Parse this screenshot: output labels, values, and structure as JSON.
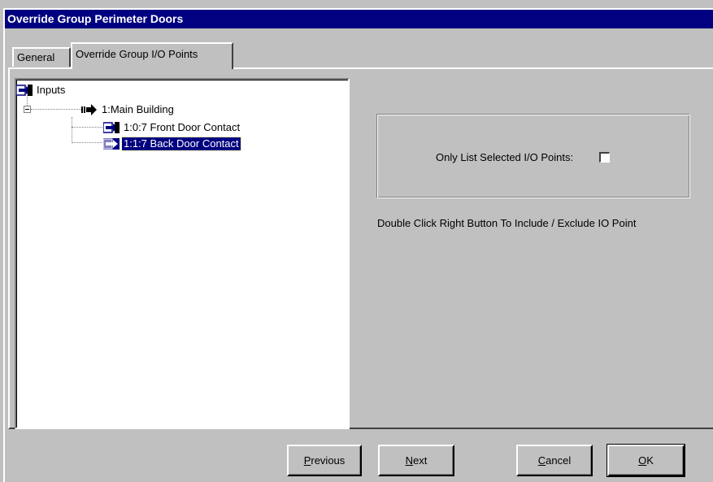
{
  "window": {
    "title": "Override Group Perimeter Doors"
  },
  "tabs": [
    {
      "label": "General",
      "active": false
    },
    {
      "label": "Override Group I/O Points",
      "active": true
    }
  ],
  "tree": {
    "root": {
      "label": "Inputs",
      "icon": "io-point-icon"
    },
    "group": {
      "label": "1:Main Building",
      "icon": "arrow-right-icon",
      "expanded": true
    },
    "items": [
      {
        "label": "1:0:7  Front Door Contact",
        "icon": "io-point-icon",
        "selected": false
      },
      {
        "label": "1:1:7  Back Door Contact",
        "icon": "io-point-icon",
        "selected": true
      }
    ]
  },
  "options": {
    "only_list_selected_label": "Only List Selected I/O Points:",
    "only_list_selected_checked": false
  },
  "hint": "Double Click Right Button To Include / Exclude IO Point",
  "buttons": {
    "previous": {
      "mnemonic": "P",
      "rest": "revious"
    },
    "next": {
      "mnemonic": "N",
      "rest": "ext"
    },
    "cancel": {
      "mnemonic": "C",
      "rest": "ancel"
    },
    "ok": {
      "mnemonic": "O",
      "rest": "K"
    }
  },
  "colors": {
    "titlebar": "#000080",
    "face": "#c0c0c0",
    "selection": "#000080"
  }
}
